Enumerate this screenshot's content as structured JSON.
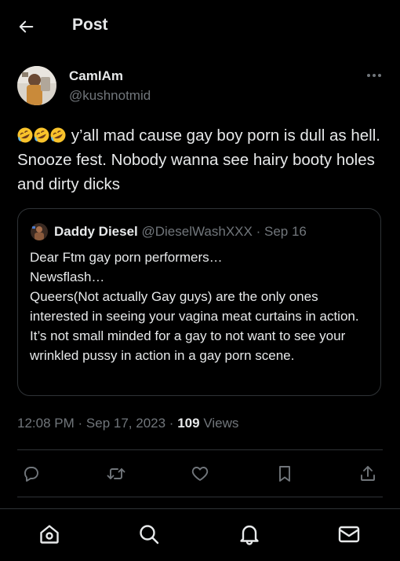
{
  "header": {
    "title": "Post"
  },
  "post": {
    "author_name": "CamIAm",
    "author_handle": "@kushnotmid",
    "text": "y’all mad cause gay boy porn is dull as hell. Snooze fest. Nobody wanna see hairy booty holes and dirty dicks",
    "emojis": [
      "rolling-on-the-floor-laughing",
      "rolling-on-the-floor-laughing",
      "rolling-on-the-floor-laughing"
    ],
    "time": "12:08 PM",
    "date": "Sep 17, 2023",
    "views_count": "109",
    "views_label": "Views"
  },
  "quote": {
    "author_name": "Daddy Diesel",
    "author_handle": "@DieselWashXXX",
    "date": "Sep 16",
    "lines": [
      "Dear Ftm gay porn performers…",
      "Newsflash…",
      "Queers(Not actually Gay guys) are the only ones interested in seeing your vagina meat curtains in action.",
      "It’s not small minded for a gay to not want to see your wrinkled pussy in action in a gay porn scene."
    ]
  },
  "separator": "·",
  "colors": {
    "background": "#000000",
    "text": "#e7e9ea",
    "muted": "#71767b",
    "border": "#2f3336"
  },
  "icons": {
    "back": "arrow-left-icon",
    "more": "more-horizontal-icon",
    "reply": "reply-icon",
    "repost": "repost-icon",
    "like": "heart-icon",
    "bookmark": "bookmark-icon",
    "share": "share-icon",
    "nav": [
      "home-icon",
      "search-icon",
      "notifications-icon",
      "messages-icon"
    ]
  }
}
